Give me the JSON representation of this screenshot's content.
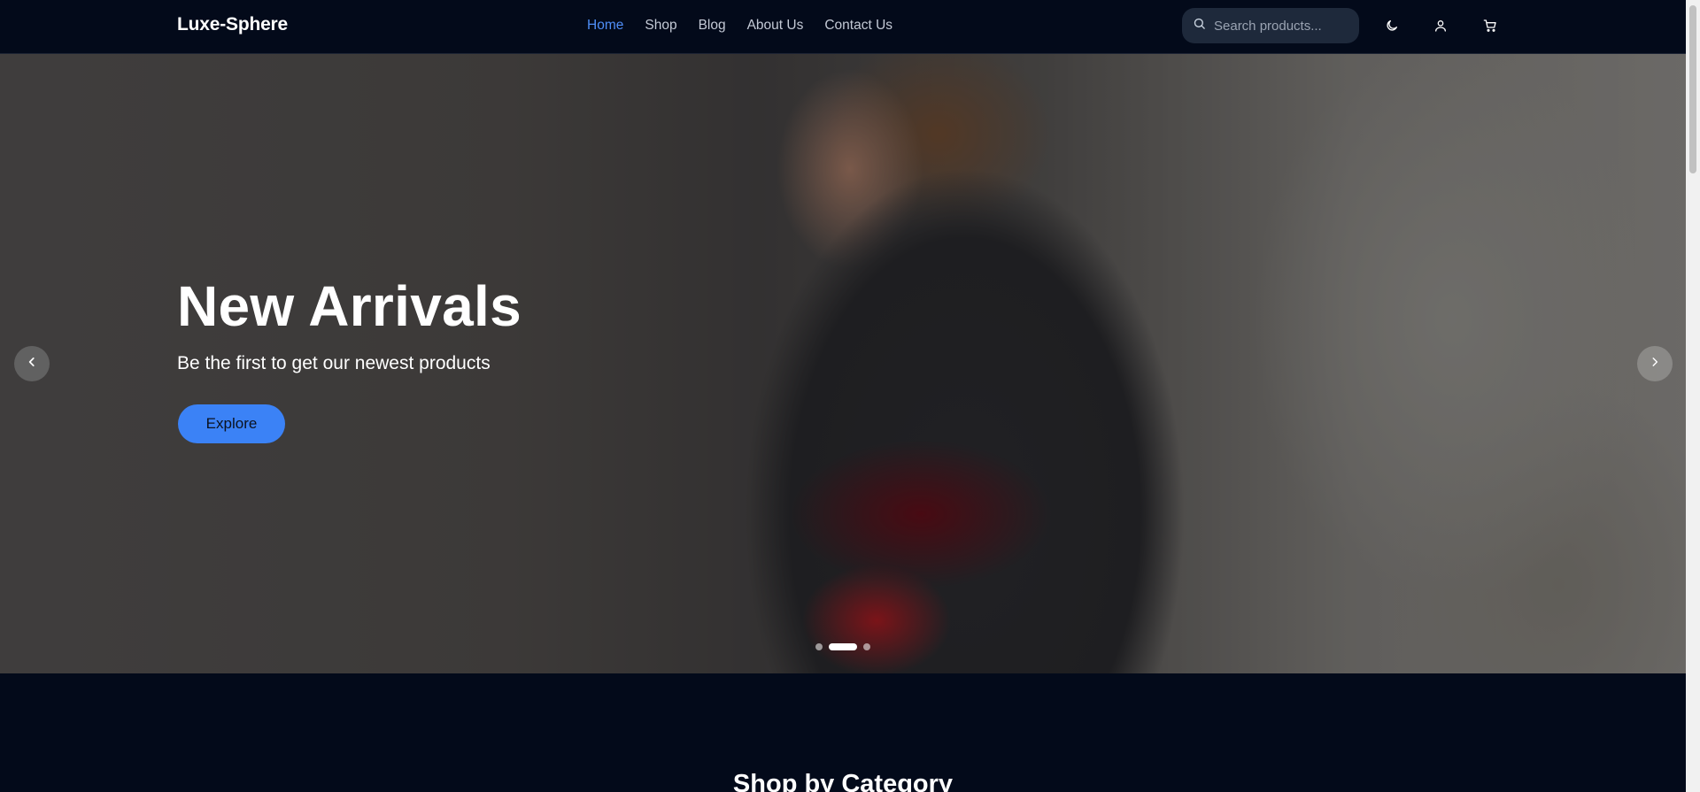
{
  "header": {
    "logo": "Luxe-Sphere",
    "nav": [
      {
        "label": "Home",
        "active": true
      },
      {
        "label": "Shop",
        "active": false
      },
      {
        "label": "Blog",
        "active": false
      },
      {
        "label": "About Us",
        "active": false
      },
      {
        "label": "Contact Us",
        "active": false
      }
    ],
    "search": {
      "placeholder": "Search products...",
      "value": "",
      "icon": "search-icon"
    },
    "icons": [
      "moon-icon",
      "user-icon",
      "cart-icon"
    ]
  },
  "hero": {
    "title": "New Arrivals",
    "subtitle": "Be the first to get our newest products",
    "cta_label": "Explore",
    "slides_total": 3,
    "active_slide": 2
  },
  "section": {
    "title": "Shop by Category"
  },
  "colors": {
    "background": "#030a1a",
    "accent": "#3b82f6",
    "nav_active": "#4f8ef7",
    "search_bg": "#1e293b"
  }
}
